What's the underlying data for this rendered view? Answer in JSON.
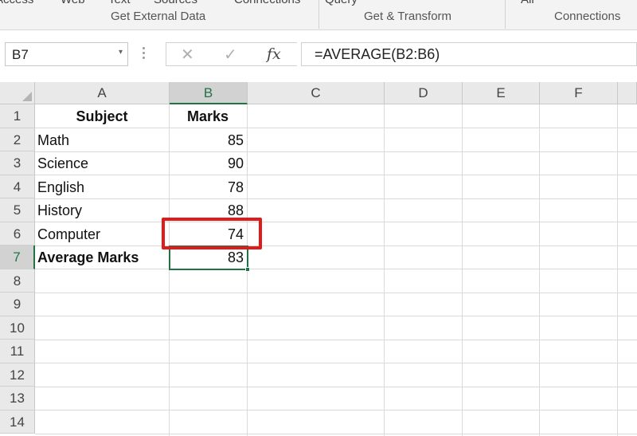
{
  "ribbon": {
    "top_fragments": [
      "Access",
      "Web",
      "Text",
      "Sources",
      "Connections",
      "Query",
      "All"
    ],
    "groups": [
      "Get External Data",
      "Get & Transform",
      "Connections"
    ]
  },
  "formula_bar": {
    "name_box": "B7",
    "name_box_arrow": "▾",
    "cancel_symbol": "✕",
    "enter_symbol": "✓",
    "fx_symbol": "fx",
    "formula": "=AVERAGE(B2:B6)"
  },
  "sheet": {
    "columns": [
      "A",
      "B",
      "C",
      "D",
      "E",
      "F"
    ],
    "row_numbers": [
      "1",
      "2",
      "3",
      "4",
      "5",
      "6",
      "7",
      "8",
      "9",
      "10",
      "11",
      "12",
      "13",
      "14"
    ],
    "cells": {
      "A1": "Subject",
      "B1": "Marks",
      "A2": "Math",
      "B2": "85",
      "A3": "Science",
      "B3": "90",
      "A4": "English",
      "B4": "78",
      "A5": "History",
      "B5": "88",
      "A6": "Computer",
      "B6": "74",
      "A7": "Average Marks",
      "B7": "83"
    },
    "active_cell": "B7",
    "selection_color": "#217346",
    "highlight_cell": "B6",
    "highlight_color": "#e01b1b"
  }
}
